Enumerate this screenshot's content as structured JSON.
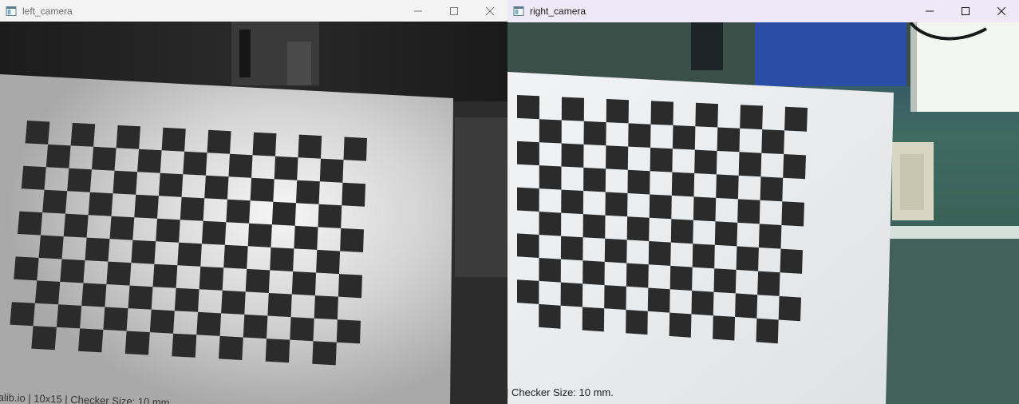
{
  "left_window": {
    "title": "left_camera",
    "overlay_text": "alib.io | 10x15 | Checker Size: 10 mm."
  },
  "right_window": {
    "title": "right_camera",
    "overlay_text": "| Checker Size: 10 mm."
  },
  "colors": {
    "left_titlebar": "#f3f3f3",
    "right_titlebar": "#efe9f7",
    "checker_square": "#2b2b2b",
    "right_wall": "#3e6b5f"
  },
  "icons": {
    "minimize": "minimize-icon",
    "maximize": "maximize-icon",
    "close": "close-icon",
    "app": "window-app-icon"
  }
}
